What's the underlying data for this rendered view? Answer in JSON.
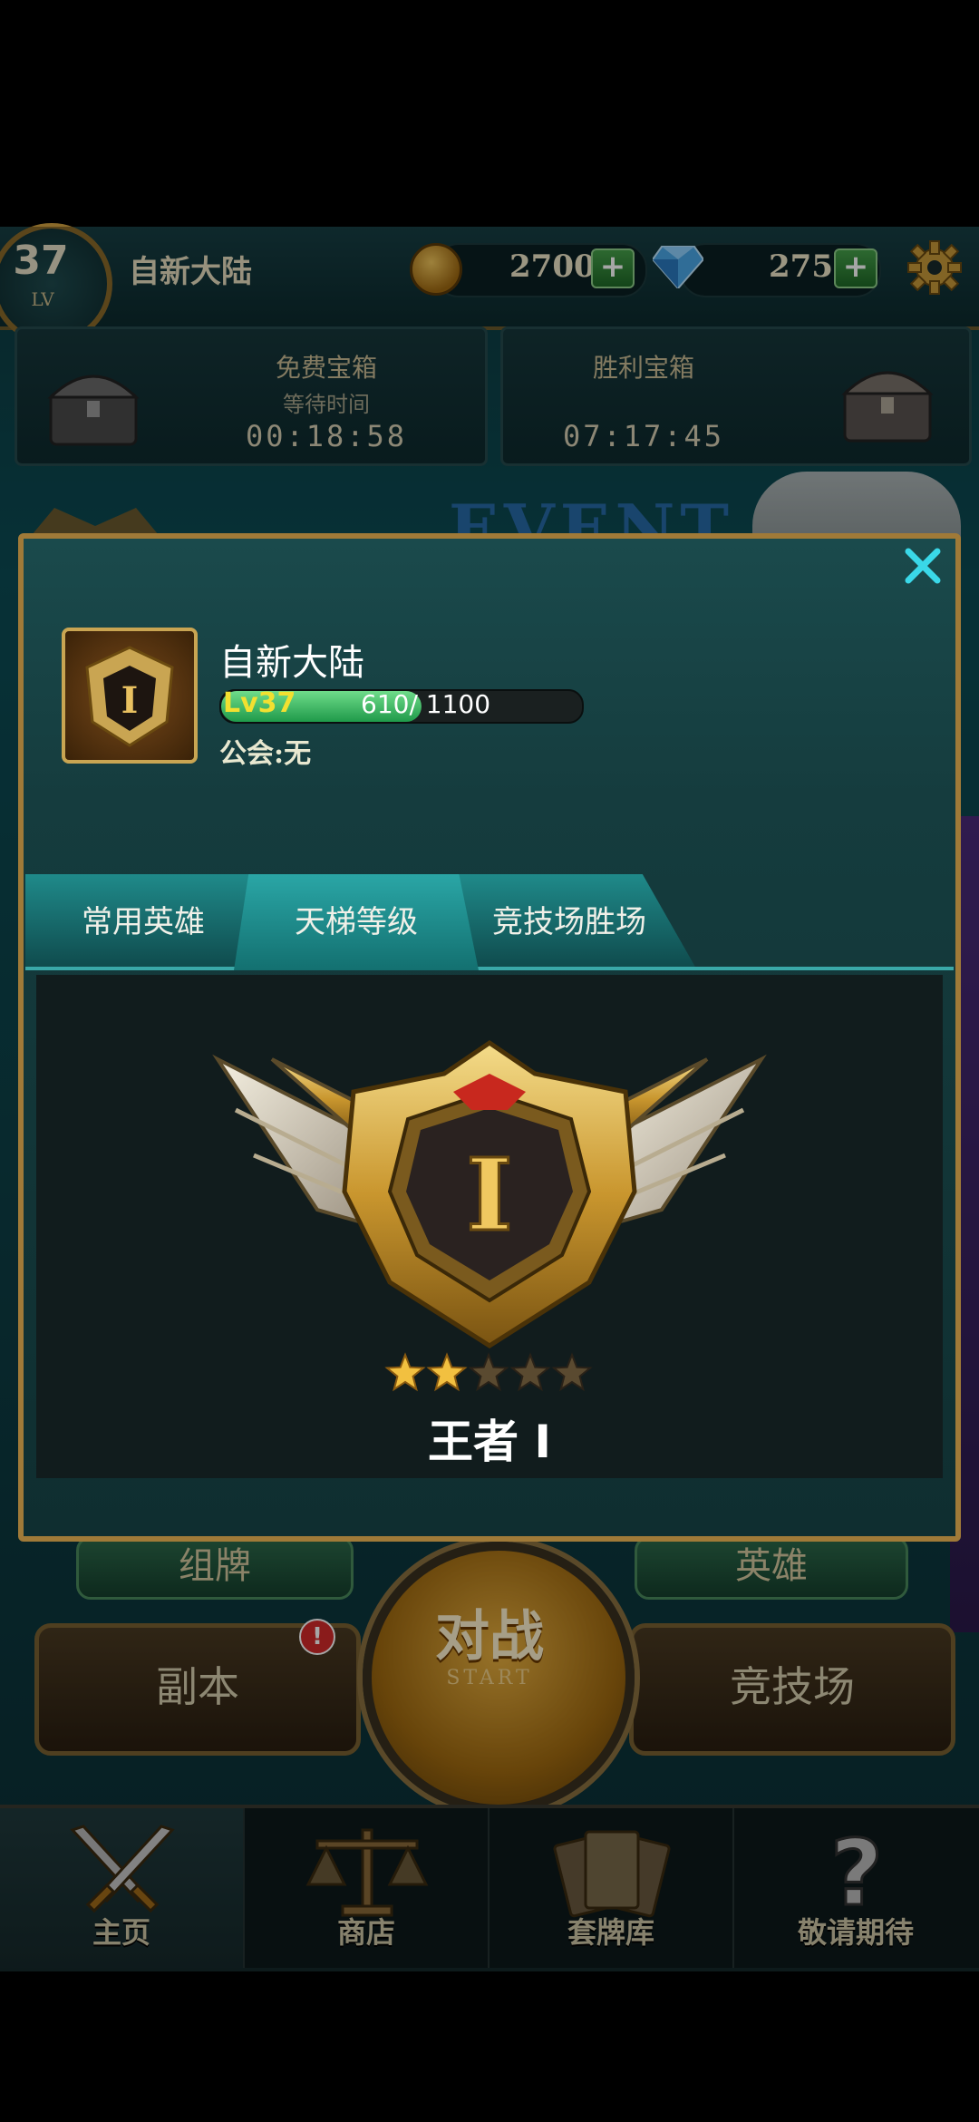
{
  "topbar": {
    "level": "37",
    "level_unit": "LV",
    "player_name": "自新大陆",
    "gold": "2700",
    "gems": "275",
    "plus": "+"
  },
  "chests": {
    "free": {
      "title": "免费宝箱",
      "subtitle": "等待时间",
      "timer": "00:18:58"
    },
    "victory": {
      "title": "胜利宝箱",
      "timer": "07:17:45"
    }
  },
  "background": {
    "event_banner": "EVENT",
    "deck_label": "组牌",
    "hero_label": "英雄",
    "dungeon_label": "副本",
    "arena_label": "竞技场",
    "battle_label": "对战",
    "battle_sub": "START",
    "alert": "!"
  },
  "modal": {
    "player_name": "自新大陆",
    "level_label": "Lv37",
    "xp_current": 610,
    "xp_max": 1100,
    "xp_text": "610/ 1100",
    "guild": "公会:无",
    "avatar_rank_numeral": "I",
    "tabs": [
      {
        "label": "常用英雄",
        "active": false
      },
      {
        "label": "天梯等级",
        "active": true
      },
      {
        "label": "竞技场胜场",
        "active": false
      }
    ],
    "rank_numeral": "I",
    "rank_name": "王者 I",
    "stars_filled": 2,
    "stars_total": 5
  },
  "nav": {
    "items": [
      {
        "label": "主页",
        "icon": "crossed-swords-icon",
        "active": true
      },
      {
        "label": "商店",
        "icon": "scales-icon",
        "active": false
      },
      {
        "label": "套牌库",
        "icon": "card-deck-icon",
        "active": false
      },
      {
        "label": "敬请期待",
        "icon": "question-mark-icon",
        "active": false
      }
    ]
  },
  "colors": {
    "accent_gold": "#c9a552",
    "tab_teal": "#1f8a8a",
    "xp_green": "#2fbf6a",
    "level_yellow": "#f2e030"
  }
}
